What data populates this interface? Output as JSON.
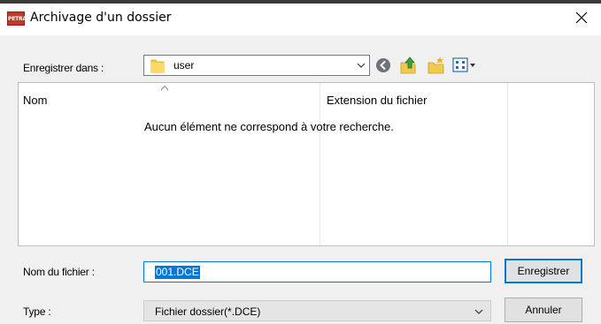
{
  "window": {
    "title": "Archivage d'un dossier",
    "app_icon_text": "PETRA"
  },
  "save_in": {
    "label": "Enregistrer dans :",
    "value": "user"
  },
  "file_list": {
    "columns": [
      "Nom",
      "Extension du fichier"
    ],
    "empty_message": "Aucun élément ne correspond à votre recherche."
  },
  "file_name": {
    "label": "Nom du fichier :",
    "value": "001.DCE"
  },
  "file_type": {
    "label": "Type :",
    "value": "Fichier dossier(*.DCE)"
  },
  "buttons": {
    "save": "Enregistrer",
    "cancel": "Annuler"
  },
  "icons": {
    "close": "close-icon",
    "folder": "folder-icon",
    "back": "back-icon",
    "up": "up-folder-icon",
    "new_folder": "new-folder-icon",
    "views": "view-menu-icon"
  },
  "colors": {
    "accent": "#0078d7",
    "app_icon": "#c0392b"
  }
}
